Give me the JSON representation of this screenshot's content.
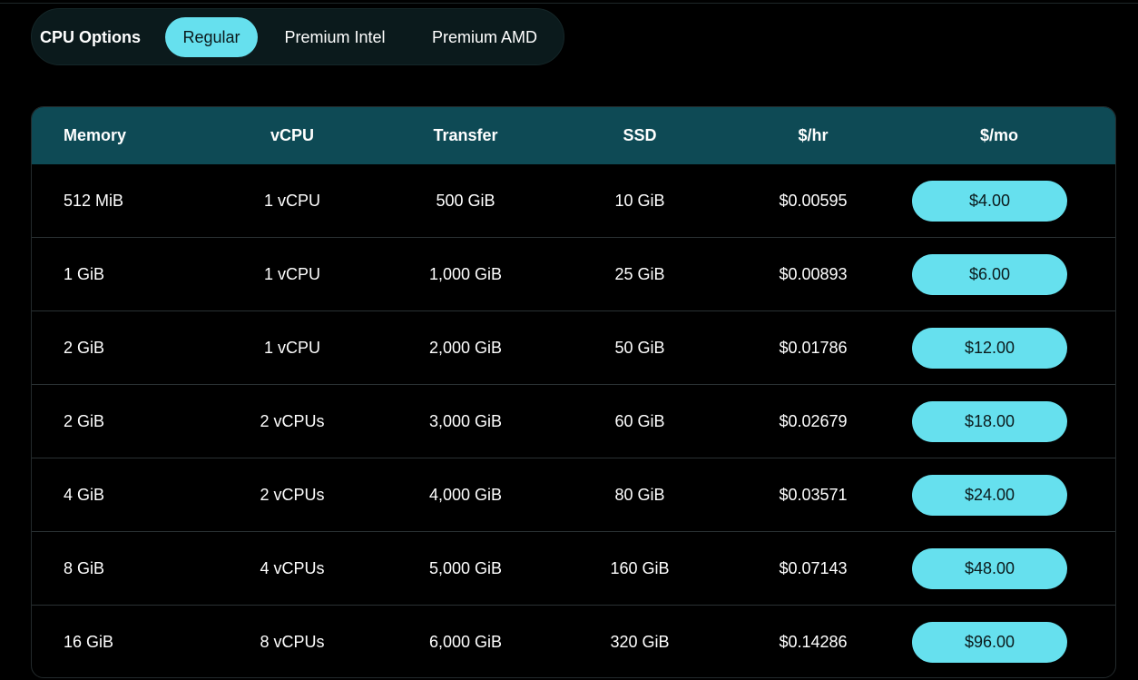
{
  "cpu_options": {
    "label": "CPU Options",
    "tabs": [
      {
        "label": "Regular",
        "active": true
      },
      {
        "label": "Premium Intel",
        "active": false
      },
      {
        "label": "Premium AMD",
        "active": false
      }
    ]
  },
  "table": {
    "headers": {
      "memory": "Memory",
      "vcpu": "vCPU",
      "transfer": "Transfer",
      "ssd": "SSD",
      "hourly": "$/hr",
      "monthly": "$/mo"
    },
    "rows": [
      {
        "memory": "512 MiB",
        "vcpu": "1 vCPU",
        "transfer": "500 GiB",
        "ssd": "10 GiB",
        "hourly": "$0.00595",
        "monthly": "$4.00"
      },
      {
        "memory": "1 GiB",
        "vcpu": "1 vCPU",
        "transfer": "1,000 GiB",
        "ssd": "25 GiB",
        "hourly": "$0.00893",
        "monthly": "$6.00"
      },
      {
        "memory": "2 GiB",
        "vcpu": "1 vCPU",
        "transfer": "2,000 GiB",
        "ssd": "50 GiB",
        "hourly": "$0.01786",
        "monthly": "$12.00"
      },
      {
        "memory": "2 GiB",
        "vcpu": "2 vCPUs",
        "transfer": "3,000 GiB",
        "ssd": "60 GiB",
        "hourly": "$0.02679",
        "monthly": "$18.00"
      },
      {
        "memory": "4 GiB",
        "vcpu": "2 vCPUs",
        "transfer": "4,000 GiB",
        "ssd": "80 GiB",
        "hourly": "$0.03571",
        "monthly": "$24.00"
      },
      {
        "memory": "8 GiB",
        "vcpu": "4 vCPUs",
        "transfer": "5,000 GiB",
        "ssd": "160 GiB",
        "hourly": "$0.07143",
        "monthly": "$48.00"
      },
      {
        "memory": "16 GiB",
        "vcpu": "8 vCPUs",
        "transfer": "6,000 GiB",
        "ssd": "320 GiB",
        "hourly": "$0.14286",
        "monthly": "$96.00"
      }
    ]
  },
  "colors": {
    "accent": "#66e0ee",
    "header_bg": "#0e4a55",
    "page_bg": "#000000"
  }
}
